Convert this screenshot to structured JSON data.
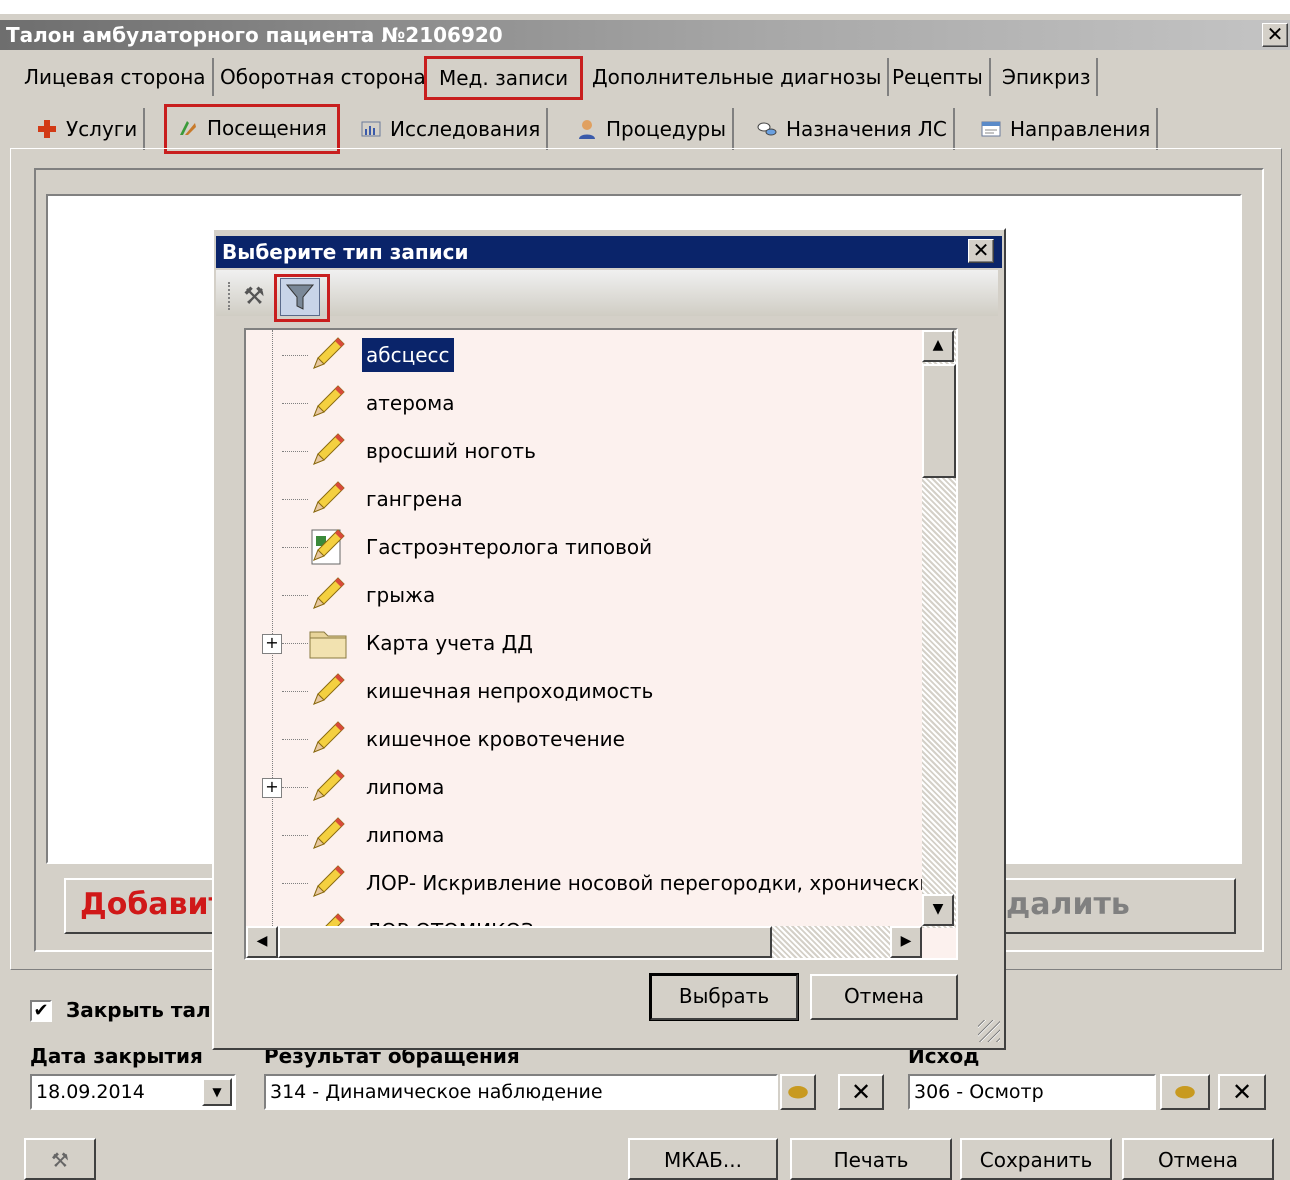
{
  "window": {
    "title": "Талон амбулаторного пациента №2106920",
    "close": "✕"
  },
  "tabs_main": [
    "Лицевая сторона",
    "Оборотная сторона",
    "Мед. записи",
    "Дополнительные диагнозы",
    "Рецепты",
    "Эпикриз"
  ],
  "tabs_sub": [
    "Услуги",
    "Посещения",
    "Исследования",
    "Процедуры",
    "Назначения ЛС",
    "Направления"
  ],
  "main_panel": {
    "add_label": "Добавит",
    "delete_label": "далить"
  },
  "bottom": {
    "close_talon_label": "Закрыть тал",
    "date_close_label": "Дата закрытия",
    "date_close_value": "18.09.2014",
    "result_label": "Результат обращения",
    "result_value": "314 - Динамическое наблюдение",
    "outcome_label": "Исход",
    "outcome_value": "306 - Осмотр",
    "buttons": {
      "mkab": "МКАБ...",
      "print": "Печать",
      "save": "Сохранить",
      "cancel": "Отмена"
    }
  },
  "dialog": {
    "title": "Выберите тип записи",
    "close": "✕",
    "items": [
      {
        "label": "абсцесс",
        "icon": "pencil-icon",
        "selected": true
      },
      {
        "label": "атерома",
        "icon": "pencil-icon"
      },
      {
        "label": "вросший ноготь",
        "icon": "pencil-icon"
      },
      {
        "label": "гангрена",
        "icon": "pencil-icon"
      },
      {
        "label": "Гастроэнтеролога типовой",
        "icon": "form-icon"
      },
      {
        "label": "грыжа",
        "icon": "pencil-icon"
      },
      {
        "label": "Карта учета ДД",
        "icon": "folder-icon",
        "expandable": true
      },
      {
        "label": "кишечная непроходимость",
        "icon": "pencil-icon"
      },
      {
        "label": "кишечное кровотечение",
        "icon": "pencil-icon"
      },
      {
        "label": "липома",
        "icon": "pencil-icon",
        "expandable": true
      },
      {
        "label": "липома",
        "icon": "pencil-icon"
      },
      {
        "label": "ЛОР- Искривление носовой перегородки, хронический",
        "icon": "pencil-icon"
      },
      {
        "label": "ЛОР ОТОМИКОЗ",
        "icon": "pencil-icon"
      }
    ],
    "select_button": "Выбрать",
    "cancel_button": "Отмена"
  },
  "highlight_color": "#c81e1e"
}
